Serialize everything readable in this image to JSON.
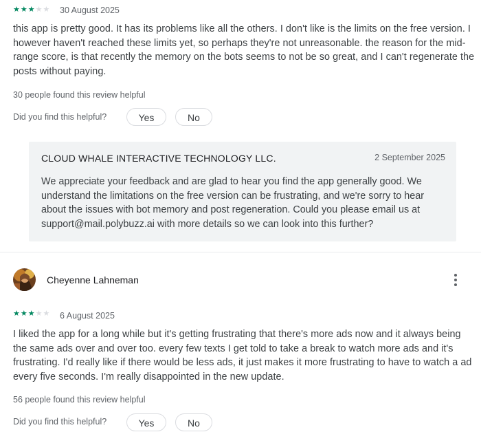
{
  "review1": {
    "rating": 3,
    "date": "30 August 2025",
    "text": "this app is pretty good. It has its problems like all the others. I don't like is the limits on the free version. I however haven't reached these limits yet, so perhaps they're not unreasonable. the reason for the mid-range score, is that recently the memory on the bots seems to not be so great, and I can't regenerate the posts without paying.",
    "helpful_count": "30 people found this review helpful",
    "helpful_question": "Did you find this helpful?",
    "yes_label": "Yes",
    "no_label": "No",
    "reply": {
      "developer": "CLOUD WHALE INTERACTIVE TECHNOLOGY LLC.",
      "date": "2 September 2025",
      "text": "We appreciate your feedback and are glad to hear you find the app generally good. We understand the limitations on the free version can be frustrating, and we're sorry to hear about the issues with bot memory and post regeneration. Could you please email us at support@mail.polybuzz.ai with more details so we can look into this further?"
    }
  },
  "review2": {
    "reviewer": "Cheyenne Lahneman",
    "rating": 3,
    "date": "6 August 2025",
    "text": "I liked the app for a long while but it's getting frustrating that there's more ads now and it always being the same ads over and over too. every few texts I get told to take a break to watch more ads and it's frustrating. I'd really like if there would be less ads, it just makes it more frustrating to have to watch a ad every five seconds. I'm really disappointed in the new update.",
    "helpful_count": "56 people found this review helpful",
    "helpful_question": "Did you find this helpful?",
    "yes_label": "Yes",
    "no_label": "No"
  },
  "colors": {
    "star_on": "#01875f",
    "star_off": "#dadce0",
    "reply_bg": "#f1f3f4"
  },
  "icons": {
    "rating": "star-icon",
    "menu": "more-vert-icon"
  }
}
